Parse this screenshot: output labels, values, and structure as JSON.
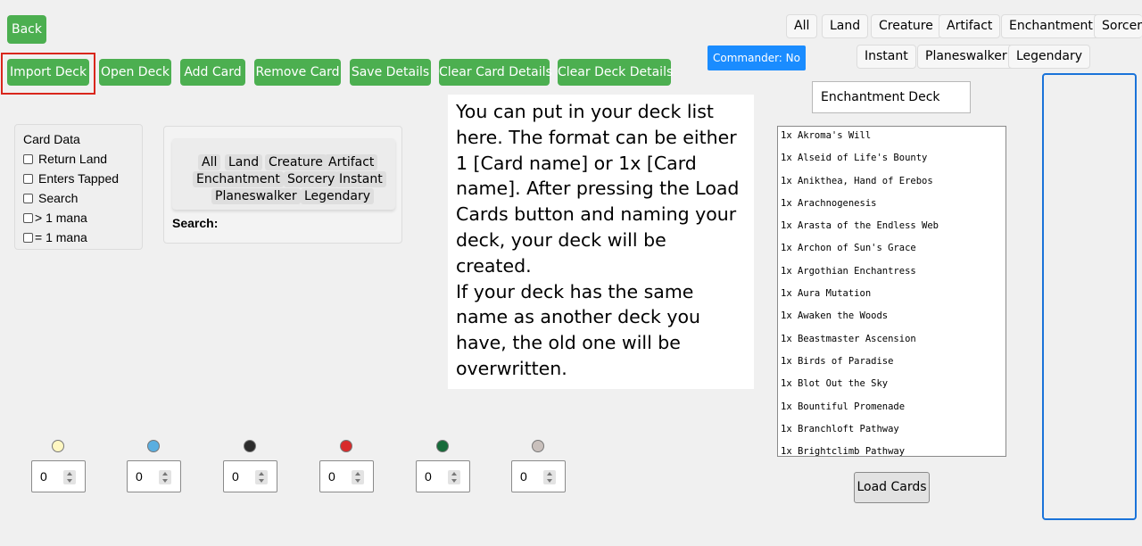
{
  "toolbar": {
    "back": "Back",
    "import_deck": "Import Deck",
    "open_deck": "Open Deck",
    "add_card": "Add Card",
    "remove_card": "Remove Card",
    "save_details": "Save Details",
    "clear_card_details": "Clear Card Details",
    "clear_deck_details": "Clear Deck Details"
  },
  "commander": "Commander: No",
  "top_filters": [
    "All",
    "Land",
    "Creature",
    "Artifact",
    "Enchantment",
    "Sorcery",
    "Instant",
    "Planeswalker",
    "Legendary"
  ],
  "deck_name": "Enchantment Deck",
  "deck_list": [
    "1x Akroma's Will",
    "1x Alseid of Life's Bounty",
    "1x Anikthea, Hand of Erebos",
    "1x Arachnogenesis",
    "1x Arasta of the Endless Web",
    "1x Archon of Sun's Grace",
    "1x Argothian Enchantress",
    "1x Aura Mutation",
    "1x Awaken the Woods",
    "1x Beastmaster Ascension",
    "1x Birds of Paradise",
    "1x Blot Out the Sky",
    "1x Bountiful Promenade",
    "1x Branchloft Pathway",
    "1x Brightclimb Pathway"
  ],
  "load_cards": "Load Cards",
  "info_text": "You can put in your deck list here. The format can be either 1 [Card name] or 1x [Card name]. After pressing the Load Cards button and naming your deck, your deck will be created.\nIf your deck has the same name as another deck you have, the old one will be overwritten.",
  "card_data": {
    "title": "Card Data",
    "options": [
      "Return Land",
      "Enters Tapped",
      "Search",
      "> 1 mana",
      "= 1 mana"
    ]
  },
  "search_filters": [
    "All",
    "Land",
    "Creature",
    "Artifact",
    "Enchantment",
    "Sorcery",
    "Instant",
    "Planeswalker",
    "Legendary"
  ],
  "search_label": "Search:",
  "mana": [
    {
      "icon": "white-mana-icon",
      "color": "#fff7c2",
      "value": "0"
    },
    {
      "icon": "blue-mana-icon",
      "color": "#5aaee0",
      "value": "0"
    },
    {
      "icon": "black-mana-icon",
      "color": "#2c2c2c",
      "value": "0"
    },
    {
      "icon": "red-mana-icon",
      "color": "#d82b2b",
      "value": "0"
    },
    {
      "icon": "green-mana-icon",
      "color": "#176b3a",
      "value": "0"
    },
    {
      "icon": "colorless-mana-icon",
      "color": "#c9c0bc",
      "value": "0"
    }
  ],
  "colors": {
    "button_green": "#4caf50",
    "commander_blue": "#1a8cff",
    "highlight_red": "#d9261c",
    "panel_border_blue": "#1a73d9"
  }
}
